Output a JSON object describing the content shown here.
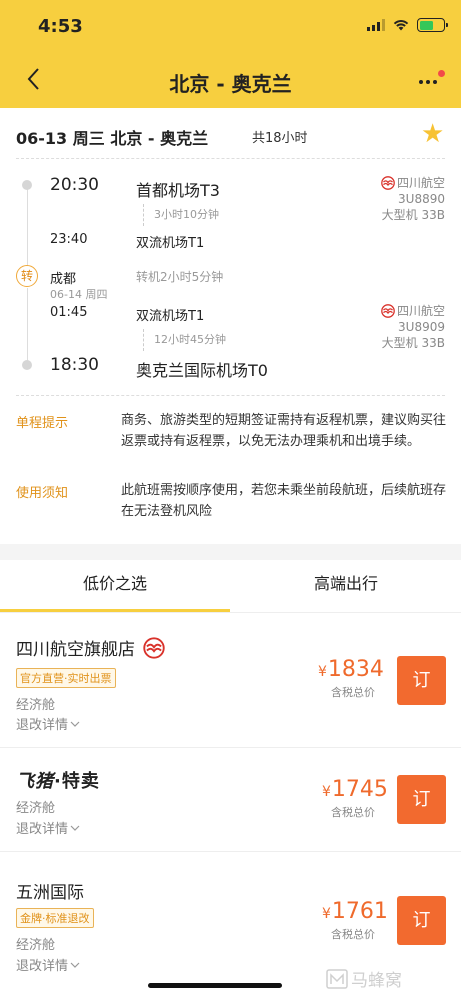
{
  "status_bar": {
    "time": "4:53"
  },
  "header": {
    "title": "北京 - 奥克兰"
  },
  "summary": {
    "route": "06-13 周三 北京 - 奥克兰",
    "total_duration": "共18小时"
  },
  "segments": {
    "first": {
      "depart_time": "20:30",
      "depart_airport": "首都机场T3",
      "flight_duration": "3小时10分钟",
      "arrive_time": "23:40",
      "arrive_airport": "双流机场T1",
      "airline": "四川航空",
      "flight_no": "3U8890",
      "aircraft": "大型机 33B"
    },
    "transfer": {
      "badge": "转",
      "city": "成都",
      "date": "06-14 周四",
      "layover": "转机2小时5分钟"
    },
    "second": {
      "depart_time": "01:45",
      "depart_airport": "双流机场T1",
      "flight_duration": "12小时45分钟",
      "arrive_time": "18:30",
      "arrive_airport": "奥克兰国际机场T0",
      "airline": "四川航空",
      "flight_no": "3U8909",
      "aircraft": "大型机 33B"
    }
  },
  "notes": [
    {
      "label": "单程提示",
      "text": "商务、旅游类型的短期签证需持有返程机票，建议购买往返票或持有返程票，以免无法办理乘机和出境手续。"
    },
    {
      "label": "使用须知",
      "text": "此航班需按顺序使用，若您未乘坐前段航班，后续航班存在无法登机风险"
    }
  ],
  "tabs": [
    {
      "label": "低价之选"
    },
    {
      "label": "高端出行"
    }
  ],
  "offers": [
    {
      "name": "四川航空旗舰店",
      "tag": "官方直营·实时出票",
      "cabin": "经济舱",
      "refund": "退改详情",
      "currency": "¥",
      "price": "1834",
      "tax_note": "含税总价",
      "book": "订"
    },
    {
      "name_a": "飞猪",
      "name_b": "·特卖",
      "cabin": "经济舱",
      "refund": "退改详情",
      "currency": "¥",
      "price": "1745",
      "tax_note": "含税总价",
      "book": "订"
    },
    {
      "name": "五洲国际",
      "tag": "金牌·标准退改",
      "cabin": "经济舱",
      "refund": "退改详情",
      "currency": "¥",
      "price": "1761",
      "tax_note": "含税总价",
      "book": "订"
    }
  ],
  "watermark": "马蜂窝",
  "colors": {
    "header_yellow": "#f7cf3f",
    "accent_orange": "#f26a2f",
    "label_orange": "#e0921a"
  }
}
